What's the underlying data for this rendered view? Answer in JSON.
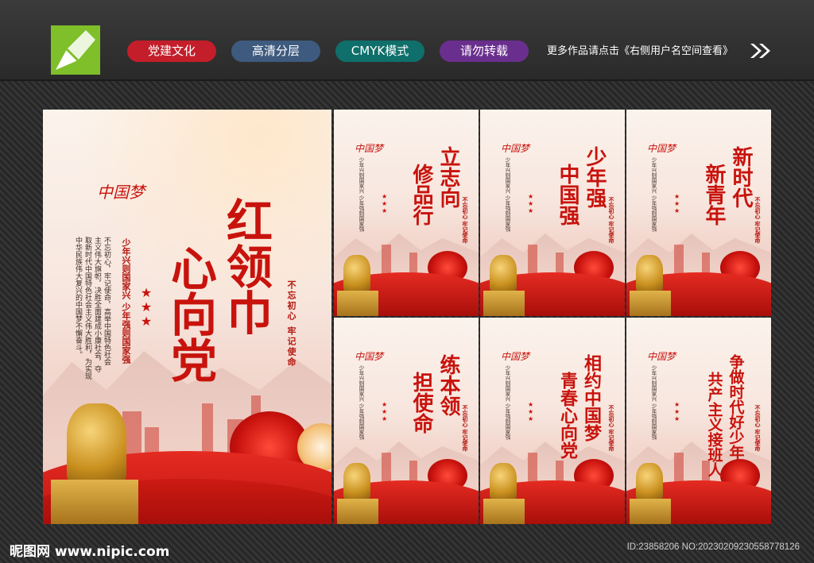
{
  "header": {
    "tags": [
      {
        "label": "党建文化",
        "color": "#c41e2a"
      },
      {
        "label": "高清分层",
        "color": "#3e5a7e"
      },
      {
        "label": "CMYK模式",
        "color": "#0f6f6a"
      },
      {
        "label": "请勿转载",
        "color": "#6a2f8e"
      }
    ],
    "more_text": "更多作品请点击《右侧用户名空间查看》",
    "arrows": "➤➤"
  },
  "main_panel": {
    "brand": "中国梦",
    "title": "红领巾心向党",
    "title_left": "心向党",
    "title_right": "红领巾",
    "slogan_right": "不忘初心 牢记使命",
    "slogan_mid": "少年兴则国家兴 少年强则国家强",
    "body_lines": [
      "不忘初心，牢记使命，高举中国特色社会",
      "主义伟大旗帜，决胜全面建成小康社会，夺",
      "取新时代中国特色社会主义伟大胜利，为实现",
      "中华民族伟大复兴的中国梦不懈奋斗。"
    ]
  },
  "small_panels": [
    {
      "brand": "中国梦",
      "title_lines": [
        "立志向",
        "修品行"
      ],
      "slogan": "不忘初心 牢记使命"
    },
    {
      "brand": "中国梦",
      "title_lines": [
        "少年强",
        "中国强"
      ],
      "slogan": "不忘初心 牢记使命"
    },
    {
      "brand": "中国梦",
      "title_lines": [
        "新时代",
        "新青年"
      ],
      "slogan": "不忘初心 牢记使命"
    },
    {
      "brand": "中国梦",
      "title_lines": [
        "练本领",
        "担使命"
      ],
      "slogan": "不忘初心 牢记使命"
    },
    {
      "brand": "中国梦",
      "title_lines": [
        "相约中国梦",
        "青春心向党"
      ],
      "slogan": "不忘初心 牢记使命"
    },
    {
      "brand": "中国梦",
      "title_lines": [
        "争做时代好少年",
        "共产主义接班人"
      ],
      "slogan": "不忘初心 牢记使命"
    }
  ],
  "small_body": "少年兴则国家兴 少年强则国家强",
  "footer": {
    "site": "昵图网 www.nipic.com",
    "id_text": "ID:23858206 NO:20230209230558778126"
  }
}
